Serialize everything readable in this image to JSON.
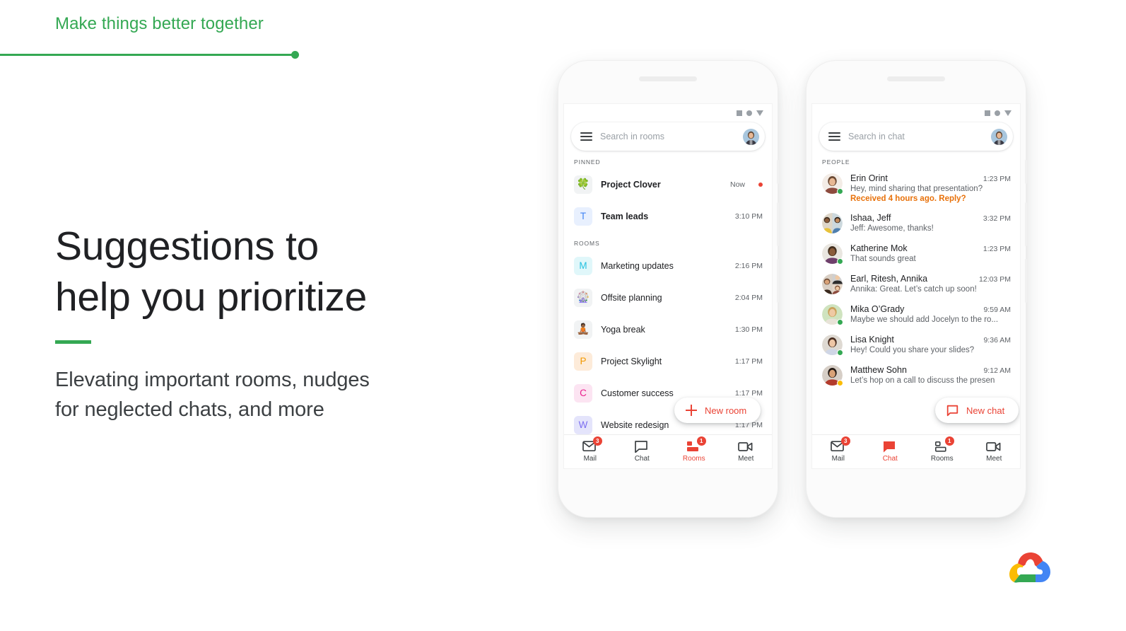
{
  "slide": {
    "eyebrow": "Make things better together",
    "headline_line1": "Suggestions to",
    "headline_line2": "help you prioritize",
    "subcopy_line1": "Elevating important rooms, nudges",
    "subcopy_line2": "for neglected chats, and more",
    "accent_green": "#34a853",
    "accent_red": "#ea4335",
    "accent_orange": "#e8710a",
    "logo_name": "google-cloud-logo"
  },
  "phone_rooms": {
    "search": {
      "placeholder": "Search in rooms",
      "menu_icon": "hamburger-menu-icon",
      "avatar": "user-avatar"
    },
    "status_icons": [
      "square-icon",
      "circle-icon",
      "triangle-down-icon"
    ],
    "sections": [
      {
        "label": "PINNED",
        "rooms": [
          {
            "avatar_glyph": "🍀",
            "avatar_bg": "#f1f3f4",
            "avatar_fg": "#202124",
            "name": "Project Clover",
            "time": "Now",
            "pinned": true,
            "unread": true
          },
          {
            "avatar_glyph": "T",
            "avatar_bg": "#e8f0fe",
            "avatar_fg": "#4285f4",
            "name": "Team leads",
            "time": "3:10 PM",
            "pinned": true,
            "unread": false
          }
        ]
      },
      {
        "label": "ROOMS",
        "rooms": [
          {
            "avatar_glyph": "M",
            "avatar_bg": "#e0f7fa",
            "avatar_fg": "#24c1e0",
            "name": "Marketing updates",
            "time": "2:16 PM",
            "pinned": false,
            "unread": false
          },
          {
            "avatar_glyph": "🎡",
            "avatar_bg": "#f1f3f4",
            "avatar_fg": "#202124",
            "name": "Offsite planning",
            "time": "2:04 PM",
            "pinned": false,
            "unread": false
          },
          {
            "avatar_glyph": "🧘🏾",
            "avatar_bg": "#f1f3f4",
            "avatar_fg": "#202124",
            "name": "Yoga break",
            "time": "1:30 PM",
            "pinned": false,
            "unread": false
          },
          {
            "avatar_glyph": "P",
            "avatar_bg": "#fdebd9",
            "avatar_fg": "#f29900",
            "name": "Project Skylight",
            "time": "1:17 PM",
            "pinned": false,
            "unread": false
          },
          {
            "avatar_glyph": "C",
            "avatar_bg": "#fce4f2",
            "avatar_fg": "#e91e8c",
            "name": "Customer success",
            "time": "1:17 PM",
            "pinned": false,
            "unread": false
          },
          {
            "avatar_glyph": "W",
            "avatar_bg": "#e4e4fb",
            "avatar_fg": "#7b6ef0",
            "name": "Website redesign",
            "time": "1:17 PM",
            "pinned": false,
            "unread": false
          }
        ]
      }
    ],
    "fab": {
      "label": "New room",
      "icon": "plus-icon"
    },
    "nav": [
      {
        "label": "Mail",
        "icon": "mail-icon",
        "badge": "3",
        "active": false
      },
      {
        "label": "Chat",
        "icon": "chat-bubble-icon",
        "badge": "",
        "active": false
      },
      {
        "label": "Rooms",
        "icon": "rooms-icon",
        "badge": "1",
        "active": true
      },
      {
        "label": "Meet",
        "icon": "video-camera-icon",
        "badge": "",
        "active": false
      }
    ]
  },
  "phone_chat": {
    "search": {
      "placeholder": "Search in chat",
      "menu_icon": "hamburger-menu-icon",
      "avatar": "user-avatar"
    },
    "status_icons": [
      "square-icon",
      "circle-icon",
      "triangle-down-icon"
    ],
    "section_label": "PEOPLE",
    "conversations": [
      {
        "name": "Erin Orint",
        "time": "1:23 PM",
        "snippet": "Hey, mind sharing that presentation?",
        "nudge": "Received 4 hours ago. Reply?",
        "presence": "active",
        "avatar_kind": "photo-erin"
      },
      {
        "name": "Ishaa, Jeff",
        "time": "3:32 PM",
        "snippet": "Jeff: Awesome, thanks!",
        "nudge": "",
        "presence": "none",
        "avatar_kind": "group-ishaa-jeff"
      },
      {
        "name": "Katherine Mok",
        "time": "1:23 PM",
        "snippet": "That sounds great",
        "nudge": "",
        "presence": "active",
        "avatar_kind": "photo-katherine"
      },
      {
        "name": "Earl, Ritesh, Annika",
        "time": "12:03 PM",
        "snippet": "Annika: Great. Let’s catch up soon!",
        "nudge": "",
        "presence": "none",
        "avatar_kind": "group-earl"
      },
      {
        "name": "Mika O’Grady",
        "time": "9:59 AM",
        "snippet": "Maybe we should add Jocelyn to the ro...",
        "nudge": "",
        "presence": "active",
        "avatar_kind": "photo-mika"
      },
      {
        "name": "Lisa Knight",
        "time": "9:36 AM",
        "snippet": "Hey! Could you share your slides?",
        "nudge": "",
        "presence": "active",
        "avatar_kind": "photo-lisa"
      },
      {
        "name": "Matthew Sohn",
        "time": "9:12 AM",
        "snippet": "Let’s hop on a call to discuss the presen",
        "nudge": "",
        "presence": "away",
        "avatar_kind": "photo-matthew"
      }
    ],
    "fab": {
      "label": "New chat",
      "icon": "chat-bubble-icon"
    },
    "nav": [
      {
        "label": "Mail",
        "icon": "mail-icon",
        "badge": "3",
        "active": false
      },
      {
        "label": "Chat",
        "icon": "chat-bubble-icon",
        "badge": "",
        "active": true
      },
      {
        "label": "Rooms",
        "icon": "rooms-icon",
        "badge": "1",
        "active": false
      },
      {
        "label": "Meet",
        "icon": "video-camera-icon",
        "badge": "",
        "active": false
      }
    ]
  }
}
